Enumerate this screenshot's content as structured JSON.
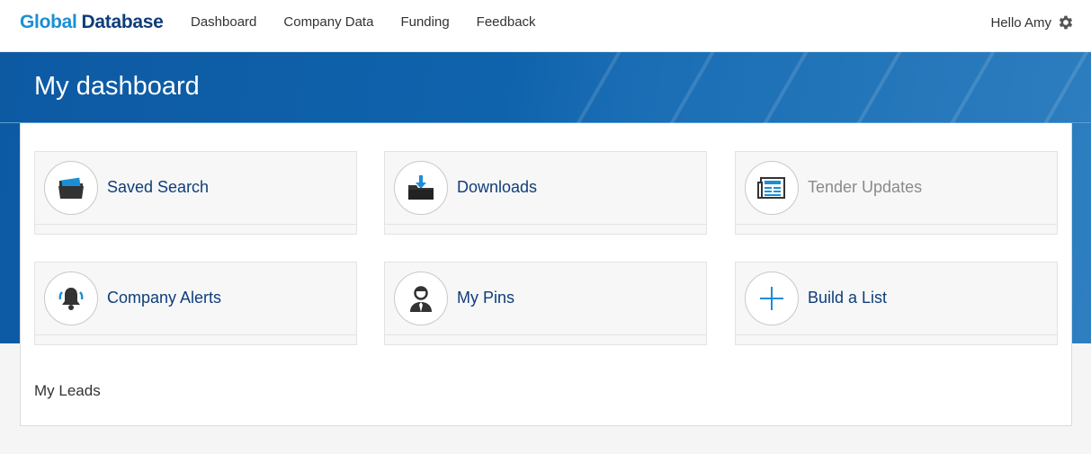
{
  "brand": {
    "part1": "Global",
    "part2": "Database"
  },
  "nav": [
    "Dashboard",
    "Company Data",
    "Funding",
    "Feedback"
  ],
  "user": {
    "greeting": "Hello Amy",
    "icon": "gear-icon"
  },
  "page": {
    "title": "My dashboard"
  },
  "tiles": [
    {
      "label": "Saved Search",
      "icon": "folder-search-icon",
      "disabled": false
    },
    {
      "label": "Downloads",
      "icon": "download-folder-icon",
      "disabled": false
    },
    {
      "label": "Tender Updates",
      "icon": "newspaper-icon",
      "disabled": true
    },
    {
      "label": "Company Alerts",
      "icon": "bell-icon",
      "disabled": false
    },
    {
      "label": "My Pins",
      "icon": "person-icon",
      "disabled": false
    },
    {
      "label": "Build a List",
      "icon": "plus-icon",
      "disabled": false
    }
  ],
  "leads": {
    "title": "My Leads"
  },
  "colors": {
    "brand_light": "#1a8fd6",
    "brand_dark": "#0f3d7a",
    "hero": "#0f63ac",
    "accent": "#1a8fd6"
  }
}
